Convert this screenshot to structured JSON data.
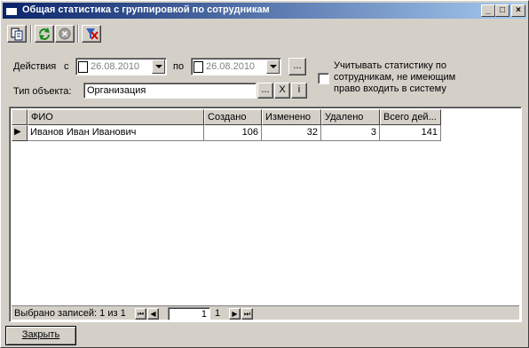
{
  "window": {
    "title": "Общая статистика с группировкой по сотрудникам",
    "buttons": {
      "minimize": "_",
      "maximize": "□",
      "close": "×"
    }
  },
  "toolbar": {
    "buttons": [
      {
        "name": "copy",
        "icon": "copy-icon"
      },
      {
        "name": "refresh",
        "icon": "refresh-icon"
      },
      {
        "name": "stop",
        "icon": "stop-icon"
      },
      {
        "name": "clear-filter",
        "icon": "clear-filter-icon"
      }
    ]
  },
  "filters": {
    "actions_label": "Действия",
    "from_label": "с",
    "date_from": "26.08.2010",
    "to_label": "по",
    "date_to": "26.08.2010",
    "period_button": "...",
    "object_type_label": "Тип объекта:",
    "object_type_value": "Организация",
    "object_browse": "...",
    "object_clear": "X",
    "object_info": "i",
    "include_disabled_label": "Учитывать статистику по сотрудникам, не имеющим право входить в систему",
    "include_disabled_checked": false
  },
  "table": {
    "columns": [
      "ФИО",
      "Создано",
      "Изменено",
      "Удалено",
      "Всего дей..."
    ],
    "rows": [
      {
        "fio": "Иванов Иван Иванович",
        "created": "106",
        "modified": "32",
        "deleted": "3",
        "total": "141"
      }
    ],
    "row_marker": "▶"
  },
  "status": {
    "selected_text": "Выбрано записей: 1 из 1",
    "page_input": "1",
    "page_total": "1",
    "nav": {
      "first": "⏮",
      "prev": "◀",
      "next": "▶",
      "last": "⏭"
    }
  },
  "footer": {
    "close_button": "Закрыть"
  }
}
